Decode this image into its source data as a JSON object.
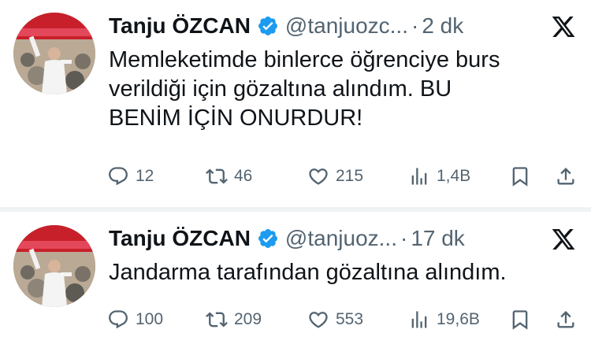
{
  "tweets": [
    {
      "author_name": "Tanju ÖZCAN",
      "handle": "@tanjuozc...",
      "separator": "·",
      "time": "2 dk",
      "lines": [
        "Memleketimde binlerce öğrenciye burs",
        "verildiği için gözaltına alındım. BU",
        "BENİM İÇİN ONURDUR!"
      ],
      "replies": "12",
      "reposts": "46",
      "likes": "215",
      "views": "1,4B"
    },
    {
      "author_name": "Tanju ÖZCAN",
      "handle": "@tanjuoz...",
      "separator": "·",
      "time": "17 dk",
      "lines": [
        "Jandarma tarafından gözaltına alındım."
      ],
      "replies": "100",
      "reposts": "209",
      "likes": "553",
      "views": "19,6B"
    }
  ],
  "icons": {
    "verified": "verified-badge-icon",
    "platform": "x-logo-icon",
    "reply": "reply-icon",
    "repost": "repost-icon",
    "like": "heart-icon",
    "views": "views-icon",
    "bookmark": "bookmark-icon",
    "share": "share-icon"
  },
  "colors": {
    "text": "#0f1419",
    "secondary": "#536471",
    "verified": "#1d9bf0",
    "separator": "#eff3f4"
  }
}
